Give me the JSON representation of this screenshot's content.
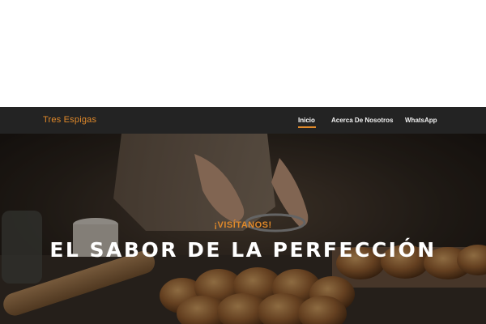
{
  "header": {
    "brand": "Tres Espigas",
    "nav": [
      {
        "label": "Inicio",
        "active": true
      },
      {
        "label": "Acerca De Nosotros",
        "active": false
      },
      {
        "label": "WhatsApp",
        "active": false
      }
    ]
  },
  "hero": {
    "tagline": "¡VISÍTANOS!",
    "headline": "EL SABOR DE LA PERFECCIÓN",
    "image": "baker-with-bread-rolls"
  },
  "colors": {
    "accent": "#e0892a",
    "navbar": "#232323",
    "text": "#ffffff"
  }
}
